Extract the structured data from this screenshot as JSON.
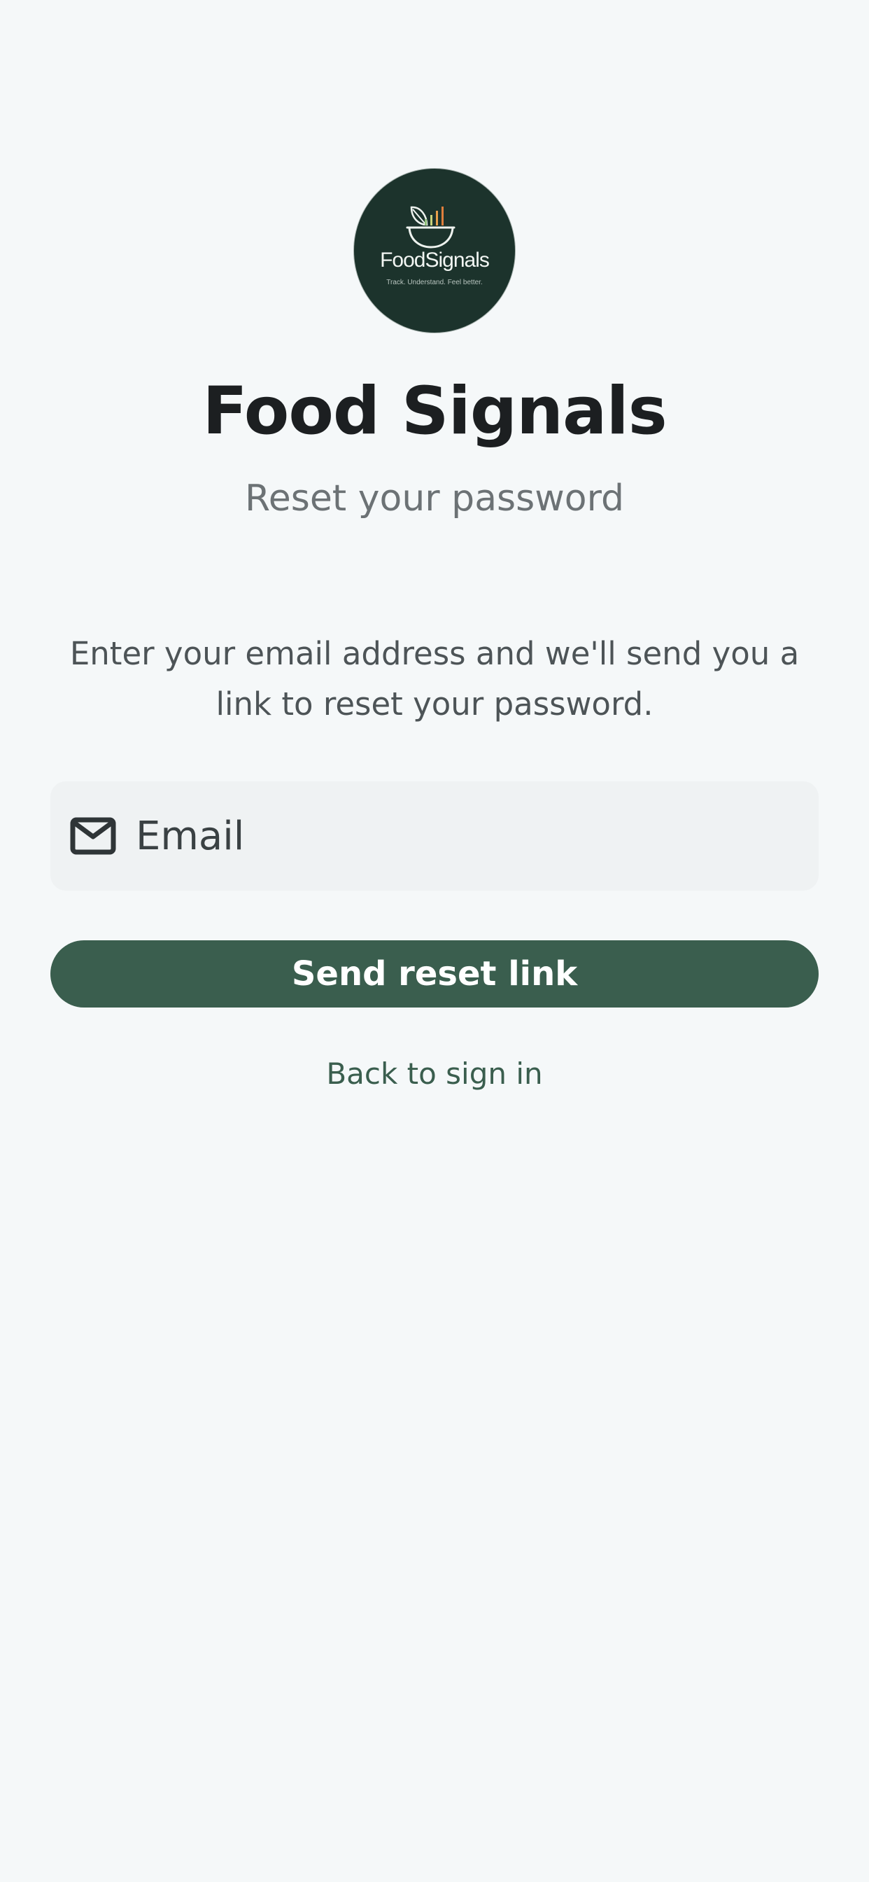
{
  "logo": {
    "wordmark": "FoodSignals",
    "tagline": "Track. Understand. Feel better.",
    "icon": "bowl-with-leaf-and-bars-icon",
    "background_color": "#1c332c"
  },
  "header": {
    "title": "Food Signals",
    "subtitle": "Reset your password"
  },
  "form": {
    "instructions": "Enter your email address and we'll send you a link to reset your password.",
    "email_placeholder": "Email",
    "email_value": "",
    "email_icon": "mail-icon",
    "submit_label": "Send reset link",
    "back_link_label": "Back to sign in"
  },
  "colors": {
    "background": "#f5f8f9",
    "primary": "#3a5e4e",
    "field_background": "#eff2f3",
    "title_text": "#1c1f21"
  }
}
